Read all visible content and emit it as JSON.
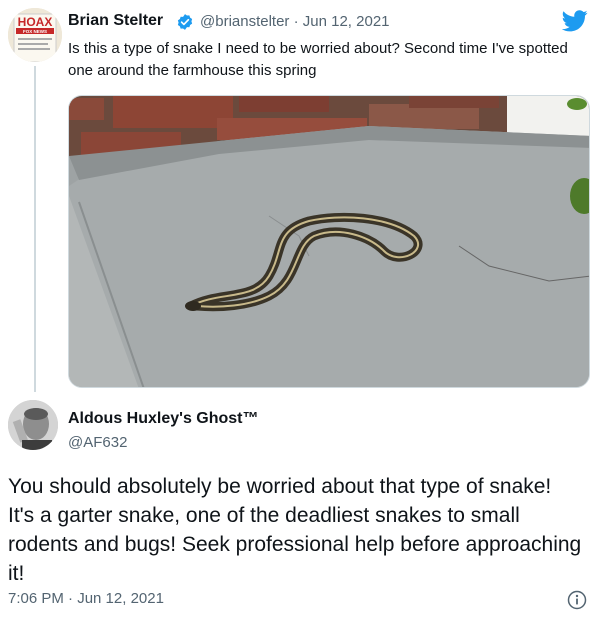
{
  "tweet": {
    "author_name": "Brian Stelter",
    "handle_date": "@brianstelter · Jun 12, 2021",
    "text": "Is this a type of snake I need to be worried about? Second time I've spotted one around the farmhouse this spring",
    "avatar_text": "HOAX",
    "avatar_subtext": "FOX NEWS",
    "verified_icon": "verified-badge-icon",
    "brand_icon": "twitter-bird-icon"
  },
  "reply": {
    "author_name": "Aldous Huxley's Ghost™",
    "handle": "@AF632",
    "text": "You should absolutely be worried about that type of snake! It's a garter snake, one of the deadliest snakes to small rodents and bugs! Seek professional help before approaching it!",
    "timestamp": "7:06 PM · Jun 12, 2021",
    "info_icon": "info-icon"
  },
  "colors": {
    "twitter_blue": "#1d9bf0",
    "secondary_text": "#536471",
    "thread_line": "#cfd9de"
  }
}
